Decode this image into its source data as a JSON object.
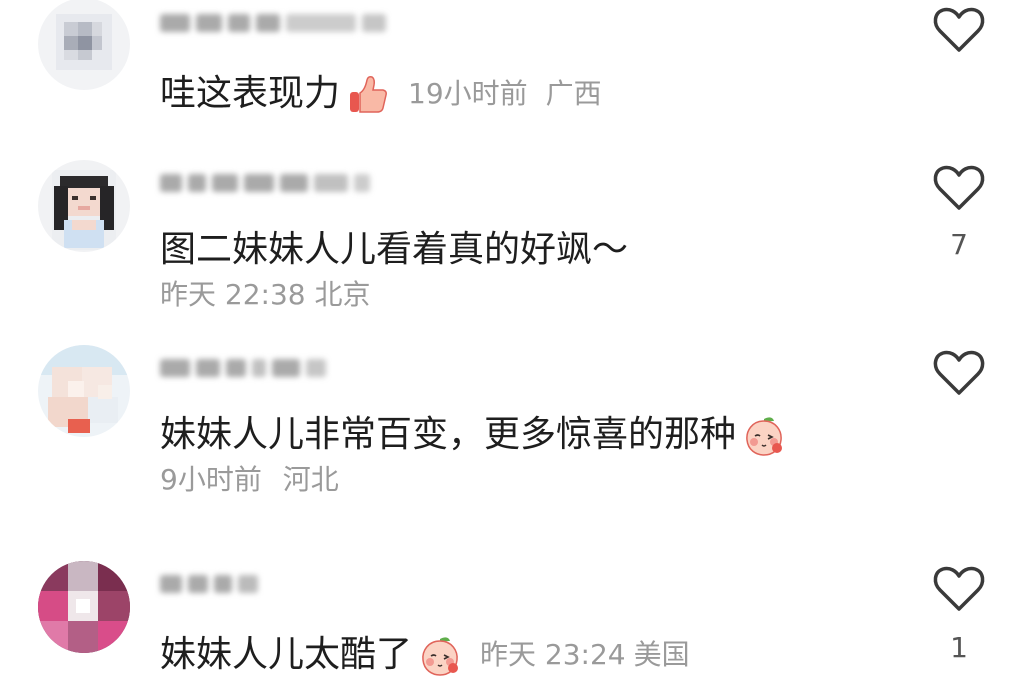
{
  "comments": [
    {
      "text": "哇这表现力",
      "emoji": "thumbs-up-emoji",
      "time": "19小时前",
      "location": "广西",
      "likes": ""
    },
    {
      "text": "图二妹妹人儿看着真的好飒～",
      "emoji": "",
      "time": "昨天 22:38",
      "location": "北京",
      "likes": "7"
    },
    {
      "text": "妹妹人儿非常百变，更多惊喜的那种",
      "emoji": "peach-blush-emoji",
      "time": "9小时前",
      "location": "河北",
      "likes": ""
    },
    {
      "text": "妹妹人儿太酷了",
      "emoji": "peach-blush-emoji",
      "time": "昨天 23:24",
      "location": "美国",
      "likes": "1"
    }
  ],
  "icons": {
    "like": "heart-outline-icon"
  },
  "colors": {
    "text": "#1e1e1e",
    "meta": "#9a9a9a",
    "icon": "#3a3a3a",
    "background": "#ffffff"
  }
}
